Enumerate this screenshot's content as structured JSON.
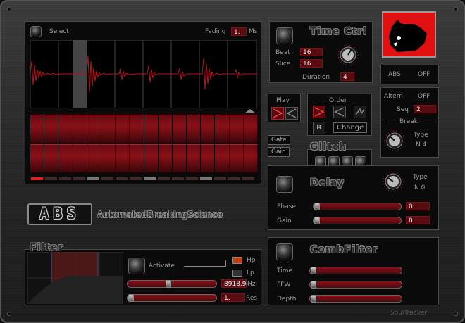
{
  "sampler": {
    "select_label": "Select",
    "fading_label": "Fading",
    "fading_value": "1.",
    "fading_unit": "Ms"
  },
  "grid": {
    "gate_label": "Gate",
    "gain_label": "Gain"
  },
  "logo": {
    "short": "ABS",
    "long": "AutomatedBreakingScience"
  },
  "time_ctrl": {
    "title": "Time Ctrl",
    "beat_label": "Beat",
    "beat_value": "16",
    "slice_label": "Slice",
    "slice_value": "16",
    "duration_label": "Duration",
    "duration_value": "4"
  },
  "abs_toggle": {
    "label": "ABS",
    "value": "OFF"
  },
  "altern": {
    "altern_label": "Altern",
    "altern_value": "OFF",
    "seq_label": "Seq",
    "seq_value": "2",
    "break_label": "Break",
    "type_label": "Type",
    "type_value": "N 4"
  },
  "play": {
    "label": "Play"
  },
  "order": {
    "label": "Order",
    "change_label": "Change",
    "reset_glyph": "R"
  },
  "glitch": {
    "title": "Glitch"
  },
  "delay": {
    "title": "Delay",
    "type_label": "Type",
    "type_value": "N 0",
    "phase_label": "Phase",
    "phase_value": "0",
    "gain_label": "Gain",
    "gain_value": "0."
  },
  "filter": {
    "title": "Filter",
    "activate_label": "Activate",
    "hp_label": "Hp",
    "lp_label": "Lp",
    "freq_value": "8918.9",
    "freq_unit": "Hz",
    "res_value": "1.",
    "res_label": "Res"
  },
  "comb": {
    "title": "CombFilter",
    "time_label": "Time",
    "ffw_label": "FFW",
    "depth_label": "Depth"
  },
  "footer": {
    "brand": "SoulTracker"
  },
  "colors": {
    "accent": "#c02030",
    "panel_bg": "#0a0a0a",
    "field_bg": "#5a0b10"
  }
}
